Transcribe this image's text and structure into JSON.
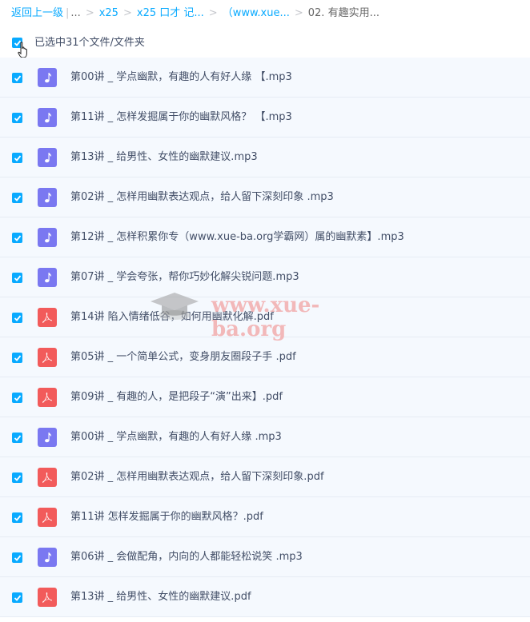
{
  "breadcrumb": {
    "back": "返回上一级",
    "ellipsis": "...",
    "items": [
      "x25",
      "x25 口才 记...",
      "（www.xue...",
      "02. 有趣实用..."
    ]
  },
  "selection": {
    "text": "已选中31个文件/文件夹"
  },
  "files": [
    {
      "name": "第00讲 _ 学点幽默，有趣的人有好人缘 【.mp3",
      "type": "mp3"
    },
    {
      "name": "第11讲 _ 怎样发掘属于你的幽默风格？ 【.mp3",
      "type": "mp3"
    },
    {
      "name": "第13讲 _ 给男性、女性的幽默建议.mp3",
      "type": "mp3"
    },
    {
      "name": "第02讲 _ 怎样用幽默表达观点，给人留下深刻印象 .mp3",
      "type": "mp3"
    },
    {
      "name": "第12讲 _ 怎样积累你专（www.xue-ba.org学霸网）属的幽默素】.mp3",
      "type": "mp3"
    },
    {
      "name": "第07讲 _ 学会夸张，帮你巧妙化解尖锐问题.mp3",
      "type": "mp3"
    },
    {
      "name": "第14讲 陷入情绪低谷，如何用幽默化解.pdf",
      "type": "pdf"
    },
    {
      "name": "第05讲 _ 一个简单公式，变身朋友圈段子手 .pdf",
      "type": "pdf"
    },
    {
      "name": "第09讲 _ 有趣的人，是把段子“演”出来】.pdf",
      "type": "pdf"
    },
    {
      "name": "第00讲 _ 学点幽默，有趣的人有好人缘 .mp3",
      "type": "mp3"
    },
    {
      "name": "第02讲 _ 怎样用幽默表达观点，给人留下深刻印象.pdf",
      "type": "pdf"
    },
    {
      "name": "第11讲 怎样发掘属于你的幽默风格？.pdf",
      "type": "pdf"
    },
    {
      "name": "第06讲 _ 会做配角，内向的人都能轻松说笑 .mp3",
      "type": "mp3"
    },
    {
      "name": "第13讲 _ 给男性、女性的幽默建议.pdf",
      "type": "pdf"
    }
  ],
  "watermark": {
    "text": "www.xue-ba.org"
  },
  "colors": {
    "accent": "#09aaff",
    "mp3_icon": "#7a78f1",
    "pdf_icon": "#f25b5b",
    "row_bg": "#f5f9fe"
  }
}
